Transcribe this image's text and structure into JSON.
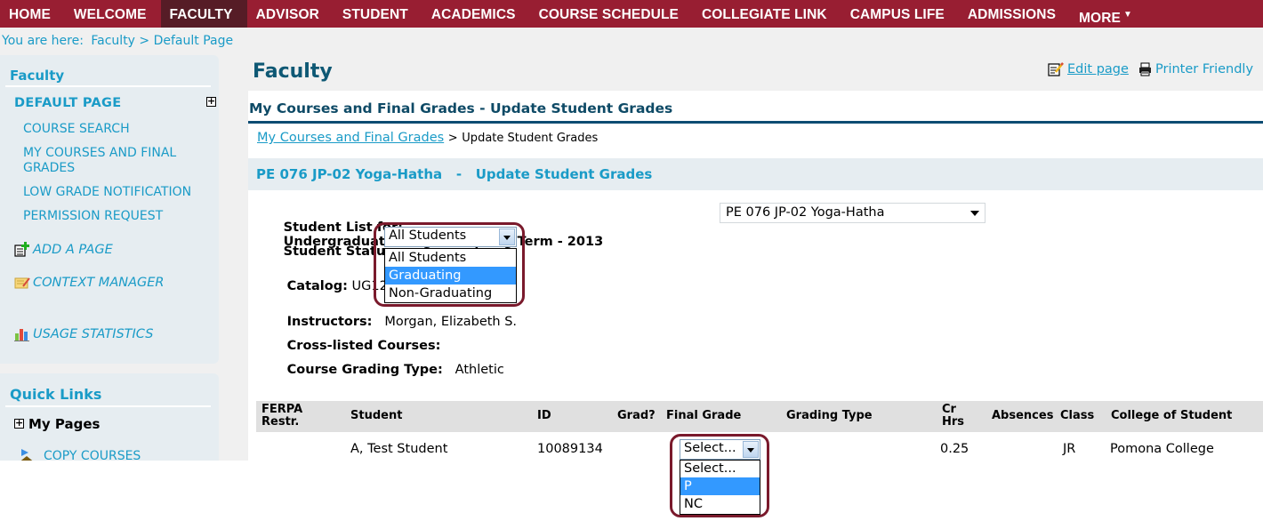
{
  "nav": {
    "items": [
      {
        "label": "HOME",
        "active": false
      },
      {
        "label": "WELCOME",
        "active": false
      },
      {
        "label": "FACULTY",
        "active": true
      },
      {
        "label": "ADVISOR",
        "active": false
      },
      {
        "label": "STUDENT",
        "active": false
      },
      {
        "label": "ACADEMICS",
        "active": false
      },
      {
        "label": "COURSE SCHEDULE",
        "active": false
      },
      {
        "label": "COLLEGIATE LINK",
        "active": false
      },
      {
        "label": "CAMPUS LIFE",
        "active": false
      },
      {
        "label": "ADMISSIONS",
        "active": false
      },
      {
        "label": "MORE",
        "active": false,
        "has_dropdown": true
      }
    ],
    "more_arrow": "▼"
  },
  "breadcrumb": {
    "prefix": "You are here:",
    "trail": "Faculty > Default Page"
  },
  "sidebar": {
    "title": "Faculty",
    "section_head": "DEFAULT PAGE",
    "expand_glyph": "+",
    "links": [
      "COURSE SEARCH",
      "MY COURSES AND FINAL GRADES",
      "LOW GRADE NOTIFICATION",
      "PERMISSION REQUEST"
    ],
    "tools": [
      {
        "icon": "add-page-icon",
        "label": "ADD A PAGE"
      },
      {
        "icon": "context-manager-icon",
        "label": "CONTEXT MANAGER"
      },
      {
        "icon": "usage-statistics-icon",
        "label": "USAGE STATISTICS"
      }
    ],
    "quick_links": {
      "title": "Quick Links",
      "my_pages": "My Pages",
      "copy_courses": "COPY COURSES"
    }
  },
  "header": {
    "title": "Faculty",
    "edit_page": "Edit page",
    "printer_friendly": "Printer Friendly"
  },
  "portlet": {
    "title": "My Courses and Final Grades - Update Student Grades",
    "crumb_link": "My Courses and Final Grades",
    "crumb_sep": ">",
    "crumb_current": "Update Student Grades",
    "course_band": "PE 076 JP-02 Yoga-Hatha   -   Update Student Grades",
    "student_list_label": "Student List for:",
    "student_list_value": "Undergraduate Program Spring Term - 2013",
    "course_select": {
      "selected": "PE 076 JP-02 Yoga-Hatha"
    },
    "status_label": "Student Status:",
    "status_select": {
      "selected": "All Students",
      "options": [
        "All Students",
        "Graduating",
        "Non-Graduating"
      ],
      "highlighted": "Graduating"
    },
    "catalog_label": "Catalog:",
    "catalog_value": "UG12",
    "instructors_label": "Instructors:",
    "instructors_value": "Morgan, Elizabeth S.",
    "cross_listed_label": "Cross-listed Courses:",
    "grading_type_label": "Course Grading Type:",
    "grading_type_value": "Athletic"
  },
  "table": {
    "columns": [
      "FERPA Restr.",
      "Student",
      "ID",
      "Grad?",
      "Final Grade",
      "Grading Type",
      "Cr Hrs",
      "Absences",
      "Class",
      "College of Student"
    ],
    "rows": [
      {
        "ferpa": "",
        "student": "A, Test Student",
        "id": "10089134",
        "grad": "",
        "final_grade": {
          "selected": "Select...",
          "options": [
            "Select...",
            "P",
            "NC"
          ],
          "highlighted": "P"
        },
        "grading_type": "",
        "cr_hrs": "0.25",
        "absences": "",
        "class": "JR",
        "college": "Pomona College"
      }
    ]
  },
  "colors": {
    "nav_bg": "#981e32",
    "nav_active": "#561c26",
    "link": "#1a9bc7",
    "title": "#0e5874",
    "highlight_ring": "#7a1a2c",
    "selected_option": "#3399ff"
  }
}
